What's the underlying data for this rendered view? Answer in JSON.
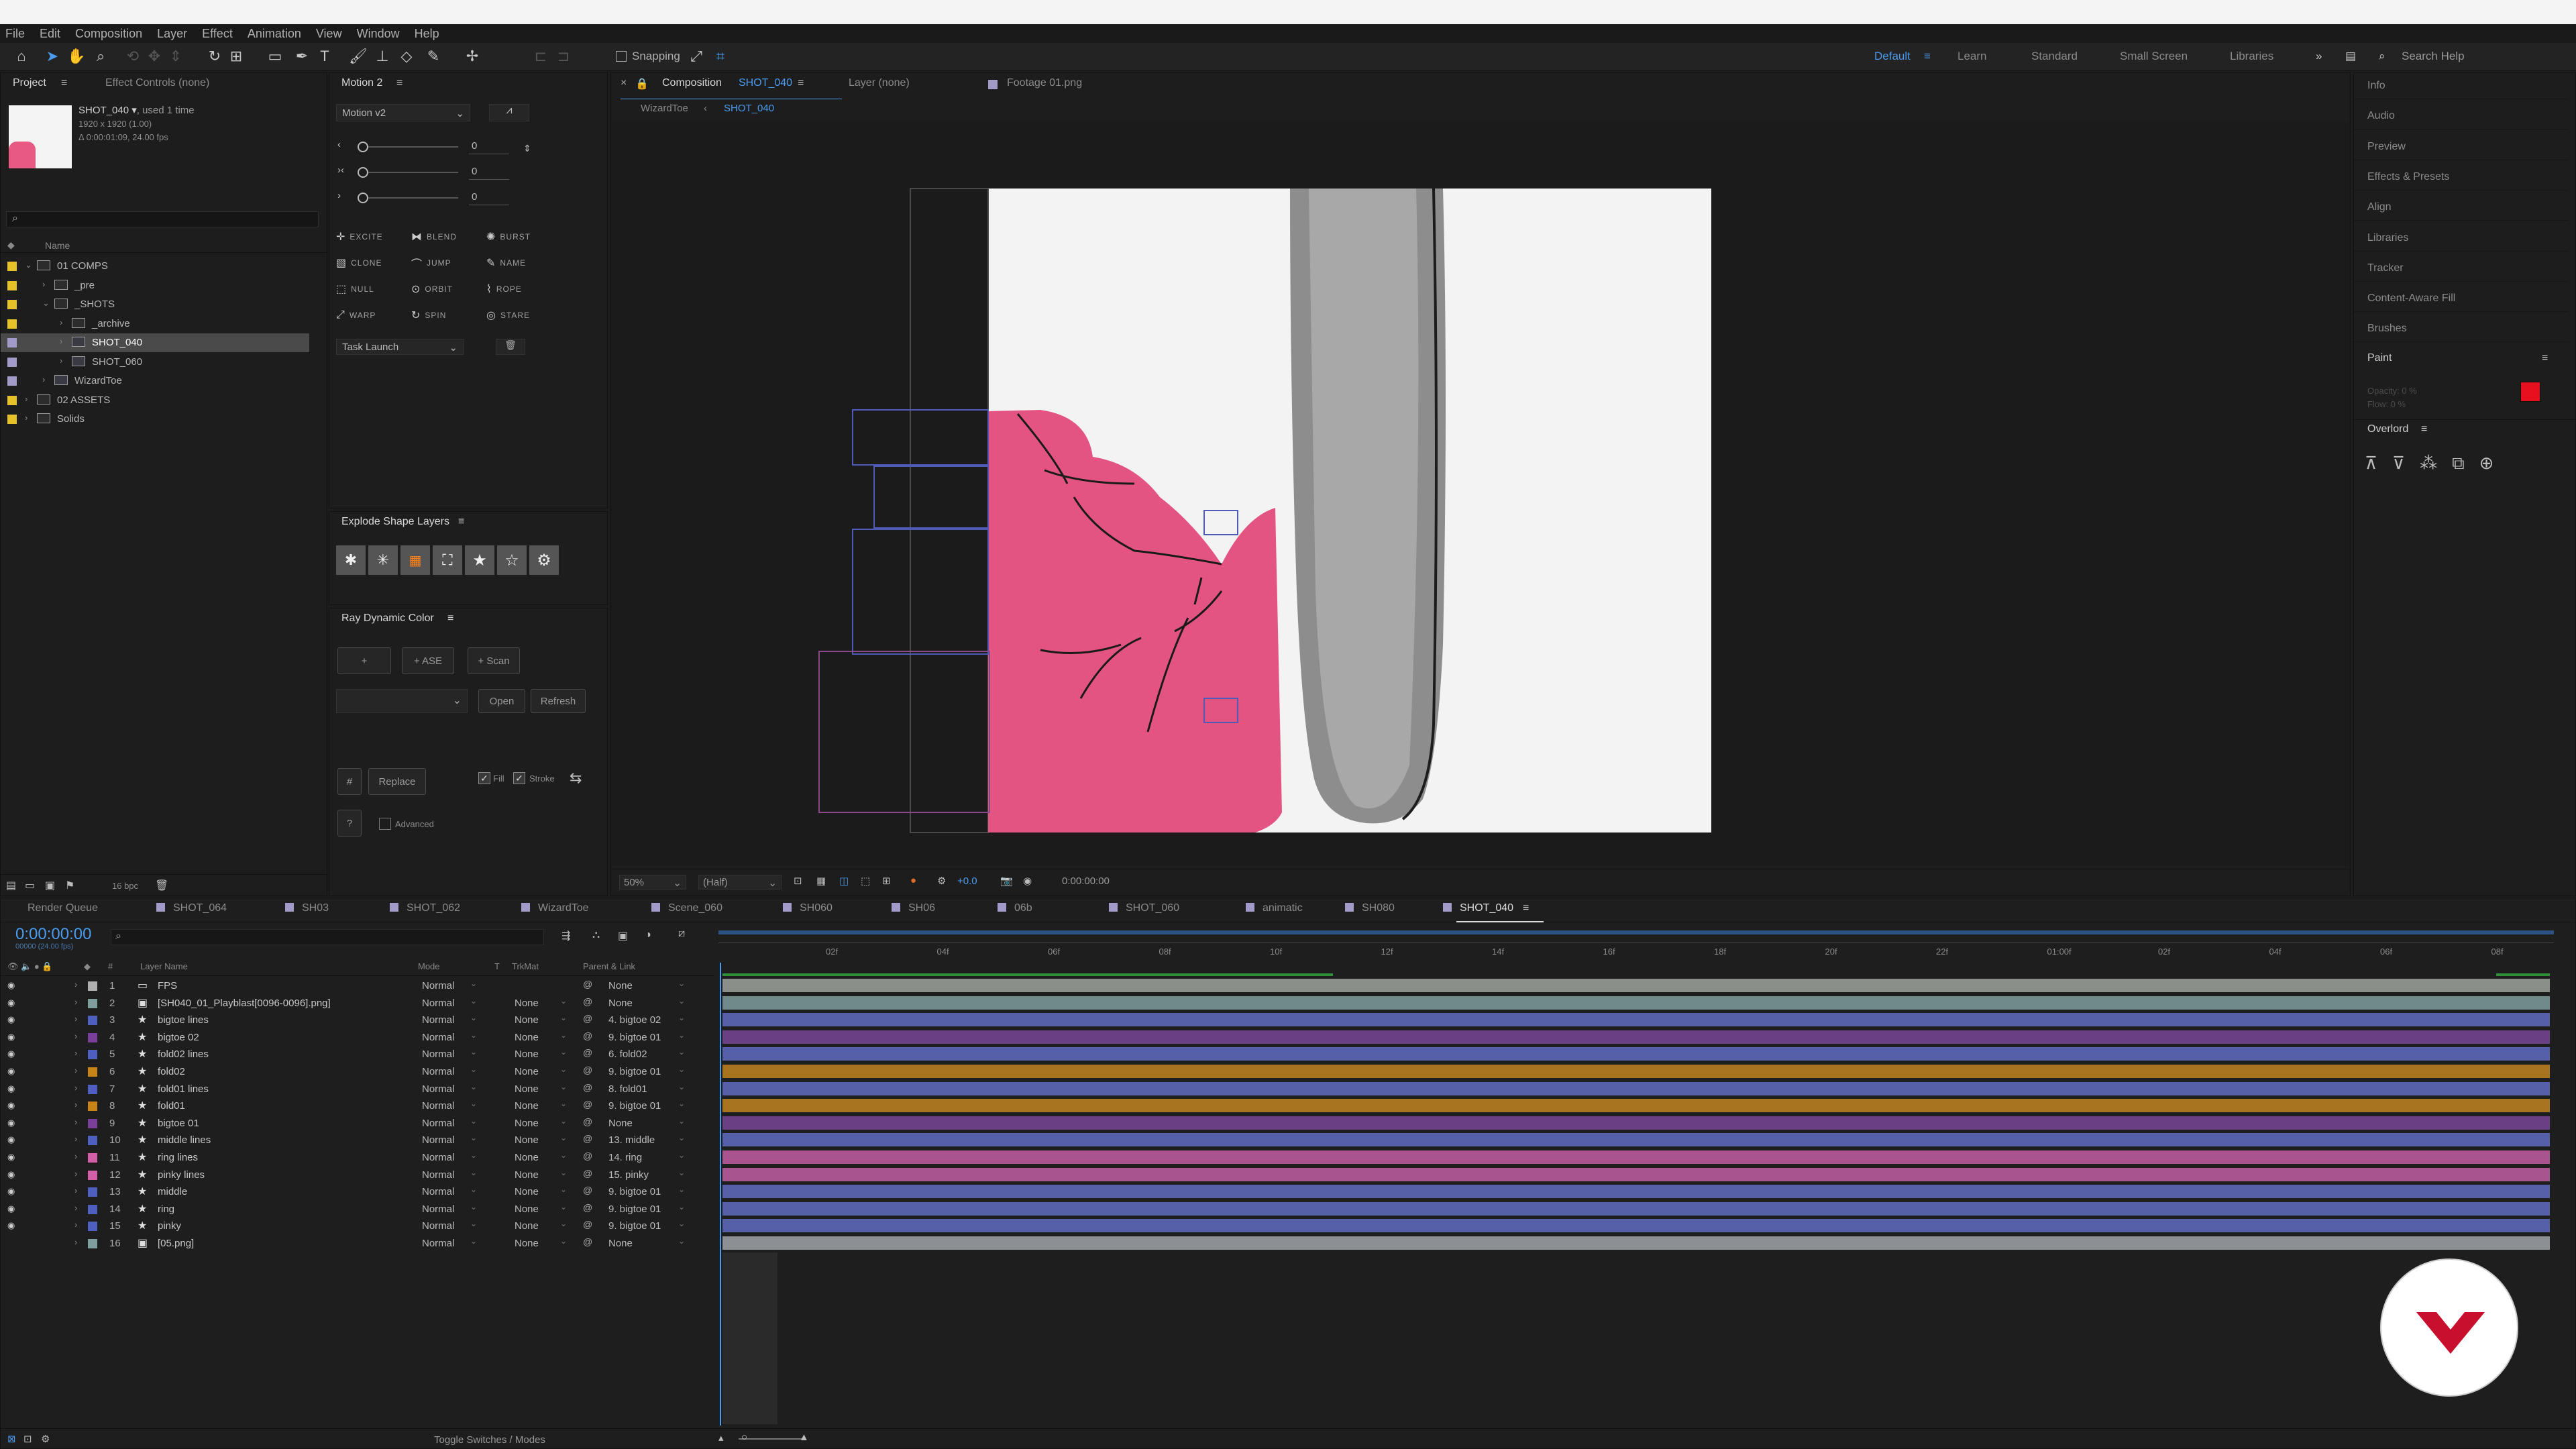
{
  "menu": [
    "File",
    "Edit",
    "Composition",
    "Layer",
    "Effect",
    "Animation",
    "View",
    "Window",
    "Help"
  ],
  "toolbar": {
    "snapping": "Snapping",
    "workspaces": [
      "Default",
      "Learn",
      "Standard",
      "Small Screen",
      "Libraries"
    ],
    "search_placeholder": "Search Help"
  },
  "project": {
    "tab": "Project",
    "tab2": "Effect Controls (none)",
    "item_name": "SHOT_040 ▾",
    "used": ", used 1 time",
    "dims": "1920 x 1920 (1.00)",
    "duration": "Δ 0:00:01:09, 24.00 fps",
    "name_header": "Name",
    "bpc": "16 bpc",
    "tree": [
      {
        "label": "01 COMPS",
        "indent": 0,
        "color": "#e6c229",
        "kind": "folder",
        "open": true
      },
      {
        "label": "_pre",
        "indent": 1,
        "color": "#e6c229",
        "kind": "folder"
      },
      {
        "label": "_SHOTS",
        "indent": 1,
        "color": "#e6c229",
        "kind": "folder",
        "open": true
      },
      {
        "label": "_archive",
        "indent": 2,
        "color": "#e6c229",
        "kind": "folder"
      },
      {
        "label": "SHOT_040",
        "indent": 2,
        "color": "#a29ac9",
        "kind": "comp",
        "selected": true
      },
      {
        "label": "SHOT_060",
        "indent": 2,
        "color": "#a29ac9",
        "kind": "comp"
      },
      {
        "label": "WizardToe",
        "indent": 1,
        "color": "#a29ac9",
        "kind": "comp"
      },
      {
        "label": "02 ASSETS",
        "indent": 0,
        "color": "#e6c229",
        "kind": "folder"
      },
      {
        "label": "Solids",
        "indent": 0,
        "color": "#e6c229",
        "kind": "folder"
      }
    ]
  },
  "motion": {
    "title": "Motion 2",
    "preset": "Motion v2",
    "sliders": [
      "0",
      "0",
      "0"
    ],
    "buttons": [
      "EXCITE",
      "BLEND",
      "BURST",
      "CLONE",
      "JUMP",
      "NAME",
      "NULL",
      "ORBIT",
      "ROPE",
      "WARP",
      "SPIN",
      "STARE"
    ],
    "task": "Task Launch"
  },
  "explode": {
    "title": "Explode Shape Layers"
  },
  "ray": {
    "title": "Ray Dynamic Color",
    "plus": "+",
    "ase": "+ ASE",
    "scan": "+ Scan",
    "open": "Open",
    "refresh": "Refresh",
    "hash": "#",
    "replace": "Replace",
    "fill": "Fill",
    "stroke": "Stroke",
    "q": "?",
    "advanced": "Advanced"
  },
  "viewer": {
    "comp_tab": "Composition",
    "comp_name": "SHOT_040",
    "layer_tab": "Layer  (none)",
    "footage_tab": "Footage  01.png",
    "crumb1": "WizardToe",
    "crumb2": "SHOT_040",
    "zoom": "50%",
    "quality": "(Half)",
    "exposure": "+0.0",
    "timecode": "0:00:00:00"
  },
  "right": {
    "items": [
      "Info",
      "Audio",
      "Preview",
      "Effects & Presets",
      "Align",
      "Libraries",
      "Tracker",
      "Content-Aware Fill",
      "Brushes"
    ],
    "paint": "Paint",
    "opacity": "Opacity:  0 %",
    "flow": "Flow:  0 %",
    "overlord": "Overlord",
    "color_fg": "#e8101e"
  },
  "timeline": {
    "tabs": [
      "Render Queue",
      "SHOT_064",
      "SH03",
      "SHOT_062",
      "WizardToe",
      "Scene_060",
      "SH060",
      "SH06",
      "06b",
      "SHOT_060",
      "animatic",
      "SH080",
      "SHOT_040"
    ],
    "timecode": "0:00:00:00",
    "fps_note": "00000 (24.00 fps)",
    "headers": {
      "num": "#",
      "name": "Layer Name",
      "mode": "Mode",
      "t": "T",
      "trkmat": "TrkMat",
      "parent": "Parent & Link"
    },
    "ruler": [
      "02f",
      "04f",
      "06f",
      "08f",
      "10f",
      "12f",
      "14f",
      "16f",
      "18f",
      "20f",
      "22f",
      "01:00f",
      "02f",
      "04f",
      "06f",
      "08f"
    ],
    "toggle": "Toggle Switches / Modes",
    "layers": [
      {
        "n": "1",
        "name": "FPS",
        "color": "#b0b0b0",
        "icon": "▭",
        "mode": "Normal",
        "trk": "",
        "parent": "None",
        "bar": "#8a8f8a"
      },
      {
        "n": "2",
        "name": "[SH040_01_Playblast[0096-0096].png]",
        "color": "#7f9f9f",
        "icon": "▣",
        "mode": "Normal",
        "trk": "None",
        "parent": "None",
        "bar": "#6f8a88"
      },
      {
        "n": "3",
        "name": "bigtoe lines",
        "color": "#4f5fbf",
        "icon": "★",
        "mode": "Normal",
        "trk": "None",
        "parent": "4. bigtoe 02",
        "bar": "#5560a8"
      },
      {
        "n": "4",
        "name": "bigtoe 02",
        "color": "#7a3f9a",
        "icon": "★",
        "mode": "Normal",
        "trk": "None",
        "parent": "9. bigtoe 01",
        "bar": "#6b3f84"
      },
      {
        "n": "5",
        "name": "fold02 lines",
        "color": "#4f5fbf",
        "icon": "★",
        "mode": "Normal",
        "trk": "None",
        "parent": "6. fold02",
        "bar": "#5560a8"
      },
      {
        "n": "6",
        "name": "fold02",
        "color": "#c98418",
        "icon": "★",
        "mode": "Normal",
        "trk": "None",
        "parent": "9. bigtoe 01",
        "bar": "#a8741f"
      },
      {
        "n": "7",
        "name": "fold01 lines",
        "color": "#4f5fbf",
        "icon": "★",
        "mode": "Normal",
        "trk": "None",
        "parent": "8. fold01",
        "bar": "#5560a8"
      },
      {
        "n": "8",
        "name": "fold01",
        "color": "#c98418",
        "icon": "★",
        "mode": "Normal",
        "trk": "None",
        "parent": "9. bigtoe 01",
        "bar": "#a8741f"
      },
      {
        "n": "9",
        "name": "bigtoe 01",
        "color": "#7a3f9a",
        "icon": "★",
        "mode": "Normal",
        "trk": "None",
        "parent": "None",
        "bar": "#6b3f84"
      },
      {
        "n": "10",
        "name": "middle lines",
        "color": "#4f5fbf",
        "icon": "★",
        "mode": "Normal",
        "trk": "None",
        "parent": "13. middle",
        "bar": "#5560a8"
      },
      {
        "n": "11",
        "name": "ring lines",
        "color": "#d25fa8",
        "icon": "★",
        "mode": "Normal",
        "trk": "None",
        "parent": "14. ring",
        "bar": "#a8558f"
      },
      {
        "n": "12",
        "name": "pinky lines",
        "color": "#d25fa8",
        "icon": "★",
        "mode": "Normal",
        "trk": "None",
        "parent": "15. pinky",
        "bar": "#a8558f"
      },
      {
        "n": "13",
        "name": "middle",
        "color": "#4f5fbf",
        "icon": "★",
        "mode": "Normal",
        "trk": "None",
        "parent": "9. bigtoe 01",
        "bar": "#5560a8"
      },
      {
        "n": "14",
        "name": "ring",
        "color": "#4f5fbf",
        "icon": "★",
        "mode": "Normal",
        "trk": "None",
        "parent": "9. bigtoe 01",
        "bar": "#5560a8"
      },
      {
        "n": "15",
        "name": "pinky",
        "color": "#4f5fbf",
        "icon": "★",
        "mode": "Normal",
        "trk": "None",
        "parent": "9. bigtoe 01",
        "bar": "#5560a8"
      },
      {
        "n": "16",
        "name": "[05.png]",
        "color": "#7f9f9f",
        "icon": "▣",
        "mode": "Normal",
        "trk": "None",
        "parent": "None",
        "bar": "#8c8f94"
      }
    ]
  }
}
